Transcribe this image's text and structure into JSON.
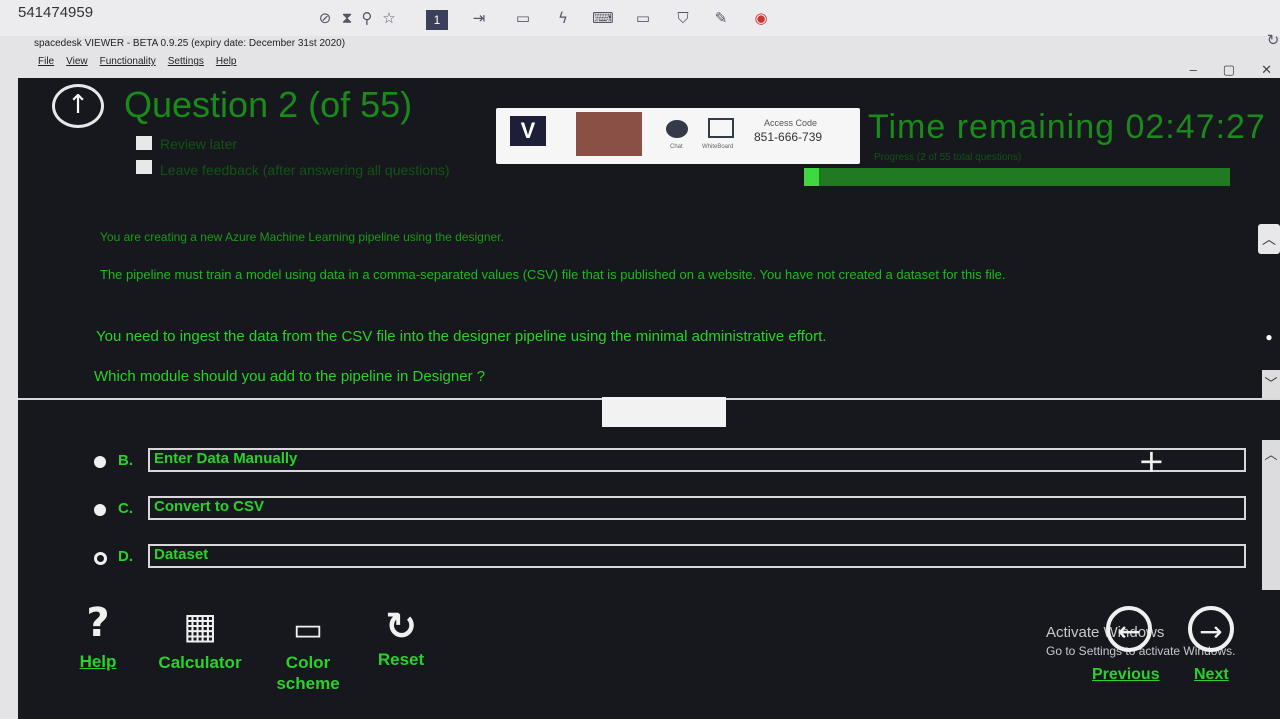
{
  "host": {
    "id_number": "541474959",
    "toolbar_page": "1"
  },
  "window": {
    "title": "spacedesk VIEWER - BETA 0.9.25 (expiry date: December 31st 2020)",
    "menu": [
      "File",
      "View",
      "Functionality",
      "Settings",
      "Help"
    ],
    "minimize": "–",
    "restore": "▢",
    "close": "✕"
  },
  "exam": {
    "question_title": "Question 2 (of 55)",
    "review_later": "Review later",
    "leave_feedback": "Leave feedback (after answering all questions)",
    "time_remaining": "Time remaining 02:47:27",
    "progress_text": "Progress (2 of 55 total questions)",
    "progress_fraction": 0.036
  },
  "overlay": {
    "logo": "V",
    "chat_label": "Chat",
    "whiteboard_label": "WhiteBoard",
    "access_code_label": "Access Code",
    "access_code": "851-666-739"
  },
  "question": {
    "p1": "You are creating a new Azure Machine Learning pipeline using the designer.",
    "p2": "The pipeline must train a model using data in a comma-separated values (CSV) file that is published on a website. You have not created a dataset for this file.",
    "p3": "You need to ingest the data from the CSV file into the designer pipeline using the minimal administrative effort.",
    "p4": "Which module should you add to the pipeline in Designer ?"
  },
  "options": [
    {
      "letter": "B.",
      "text": "Enter Data Manually"
    },
    {
      "letter": "C.",
      "text": "Convert to CSV"
    },
    {
      "letter": "D.",
      "text": "Dataset"
    }
  ],
  "tools": {
    "help": "Help",
    "calculator": "Calculator",
    "color_scheme_1": "Color",
    "color_scheme_2": "scheme",
    "reset": "Reset"
  },
  "watermark": {
    "line1": "Activate Windows",
    "line2": "Go to Settings to activate Windows."
  },
  "nav": {
    "previous": "Previous",
    "next": "Next"
  },
  "colors": {
    "exam_bg": "#16181d",
    "text_green": "#2bd12b",
    "title_green": "#1a8a1a"
  }
}
